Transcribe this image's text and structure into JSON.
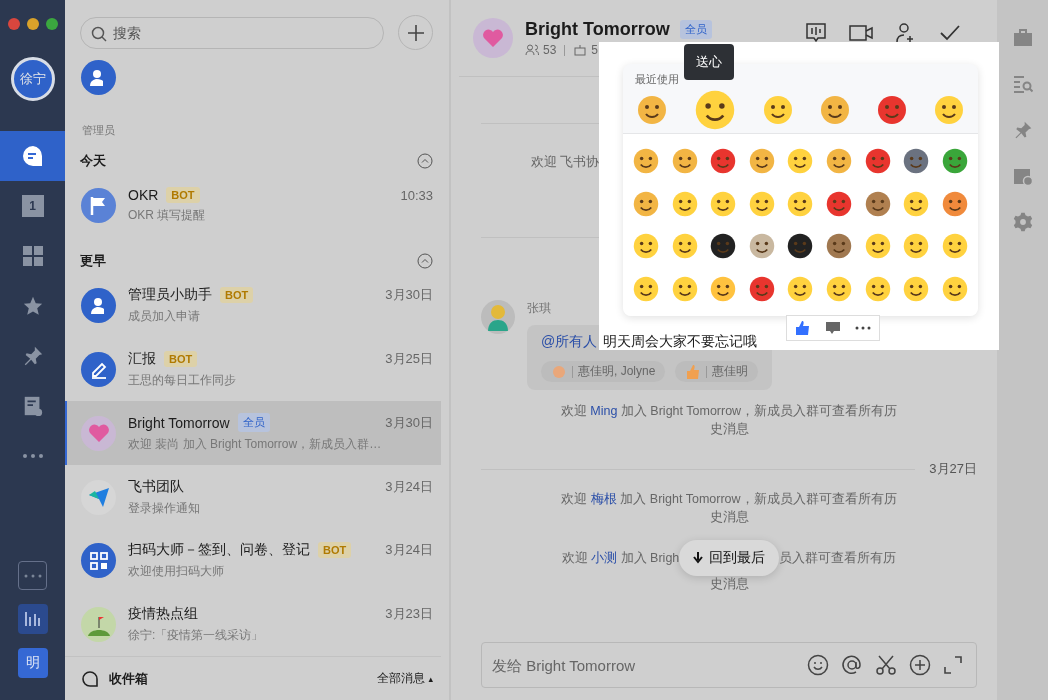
{
  "rail": {
    "avatar": "徐宁",
    "items": [
      {
        "kind": "chat",
        "selected": true
      },
      {
        "kind": "calendar",
        "label": "1",
        "selected": false
      },
      {
        "kind": "apps",
        "selected": false
      },
      {
        "kind": "star",
        "selected": false
      },
      {
        "kind": "pin",
        "selected": false
      },
      {
        "kind": "docs",
        "selected": false
      },
      {
        "kind": "more",
        "selected": false
      }
    ],
    "user": "明"
  },
  "list": {
    "search": {
      "placeholder": "搜索"
    },
    "pinned": {
      "name": "管理员"
    },
    "sections": [
      {
        "title": "今天",
        "chats": [
          {
            "kind": "flag",
            "name": "OKR",
            "tag": {
              "kind": "bot",
              "text": "BOT"
            },
            "time": "10:33",
            "preview": "OKR 填写提醒",
            "selected": false
          }
        ]
      },
      {
        "title": "更早",
        "chats": [
          {
            "kind": "admin",
            "name": "管理员小助手",
            "tag": {
              "kind": "bot",
              "text": "BOT"
            },
            "time": "3月30日",
            "preview": "成员加入申请",
            "selected": false
          },
          {
            "kind": "pen",
            "name": "汇报",
            "tag": {
              "kind": "bot",
              "text": "BOT"
            },
            "time": "3月25日",
            "preview": "王思的每日工作同步",
            "selected": false
          },
          {
            "kind": "heart",
            "name": "Bright Tomorrow",
            "tag": {
              "kind": "all",
              "text": "全员"
            },
            "time": "3月30日",
            "preview": "欢迎 裴尚 加入 Bright Tomorrow，新成员入群…",
            "selected": true
          },
          {
            "kind": "plane",
            "name": "飞书团队",
            "time": "3月24日",
            "preview": "登录操作通知",
            "selected": false
          },
          {
            "kind": "qr",
            "name": "扫码大师－签到、问卷、登记",
            "tag": {
              "kind": "bot",
              "text": "BOT"
            },
            "time": "3月24日",
            "preview": "欢迎使用扫码大师",
            "selected": false
          },
          {
            "kind": "hill",
            "name": "疫情热点组",
            "time": "3月23日",
            "preview": "徐宁:「疫情第一线采访」",
            "selected": false
          }
        ]
      }
    ],
    "footer": {
      "inbox": "收件箱",
      "filter": "全部消息",
      "filter_arrow": "▴"
    }
  },
  "chat": {
    "title": "Bright Tomorrow",
    "tag": "全员",
    "members": "53",
    "bots": "5",
    "first_system": "欢迎 飞书协",
    "message": {
      "sender": "张琪",
      "mention": "@所有人",
      "text": "明天周会大家不要忘记哦",
      "reactions": [
        {
          "kind": "ok",
          "users": "惠佳明, Jolyne"
        },
        {
          "kind": "thumb",
          "users": "惠佳明"
        }
      ]
    },
    "system": [
      {
        "pre": "欢迎",
        "name": "Ming",
        "post": "加入 Bright Tomorrow，新成员入群可查看所有历史消息"
      }
    ],
    "date": "3月27日",
    "system2": [
      {
        "pre": "欢迎",
        "name": "梅根",
        "post": "加入 Bright Tomorrow，新成员入群可查看所有历史消息"
      }
    ],
    "last": {
      "pre": "欢迎",
      "name": "小测",
      "before": "加入 Brigh",
      "after": "员入群可查看所有历",
      "tail": "史消息"
    },
    "jump": "回到最后",
    "input": {
      "placeholder": "发给 Bright Tomorrow"
    }
  },
  "emoji_panel": {
    "tooltip": "送心",
    "recent_title": "最近使用"
  }
}
